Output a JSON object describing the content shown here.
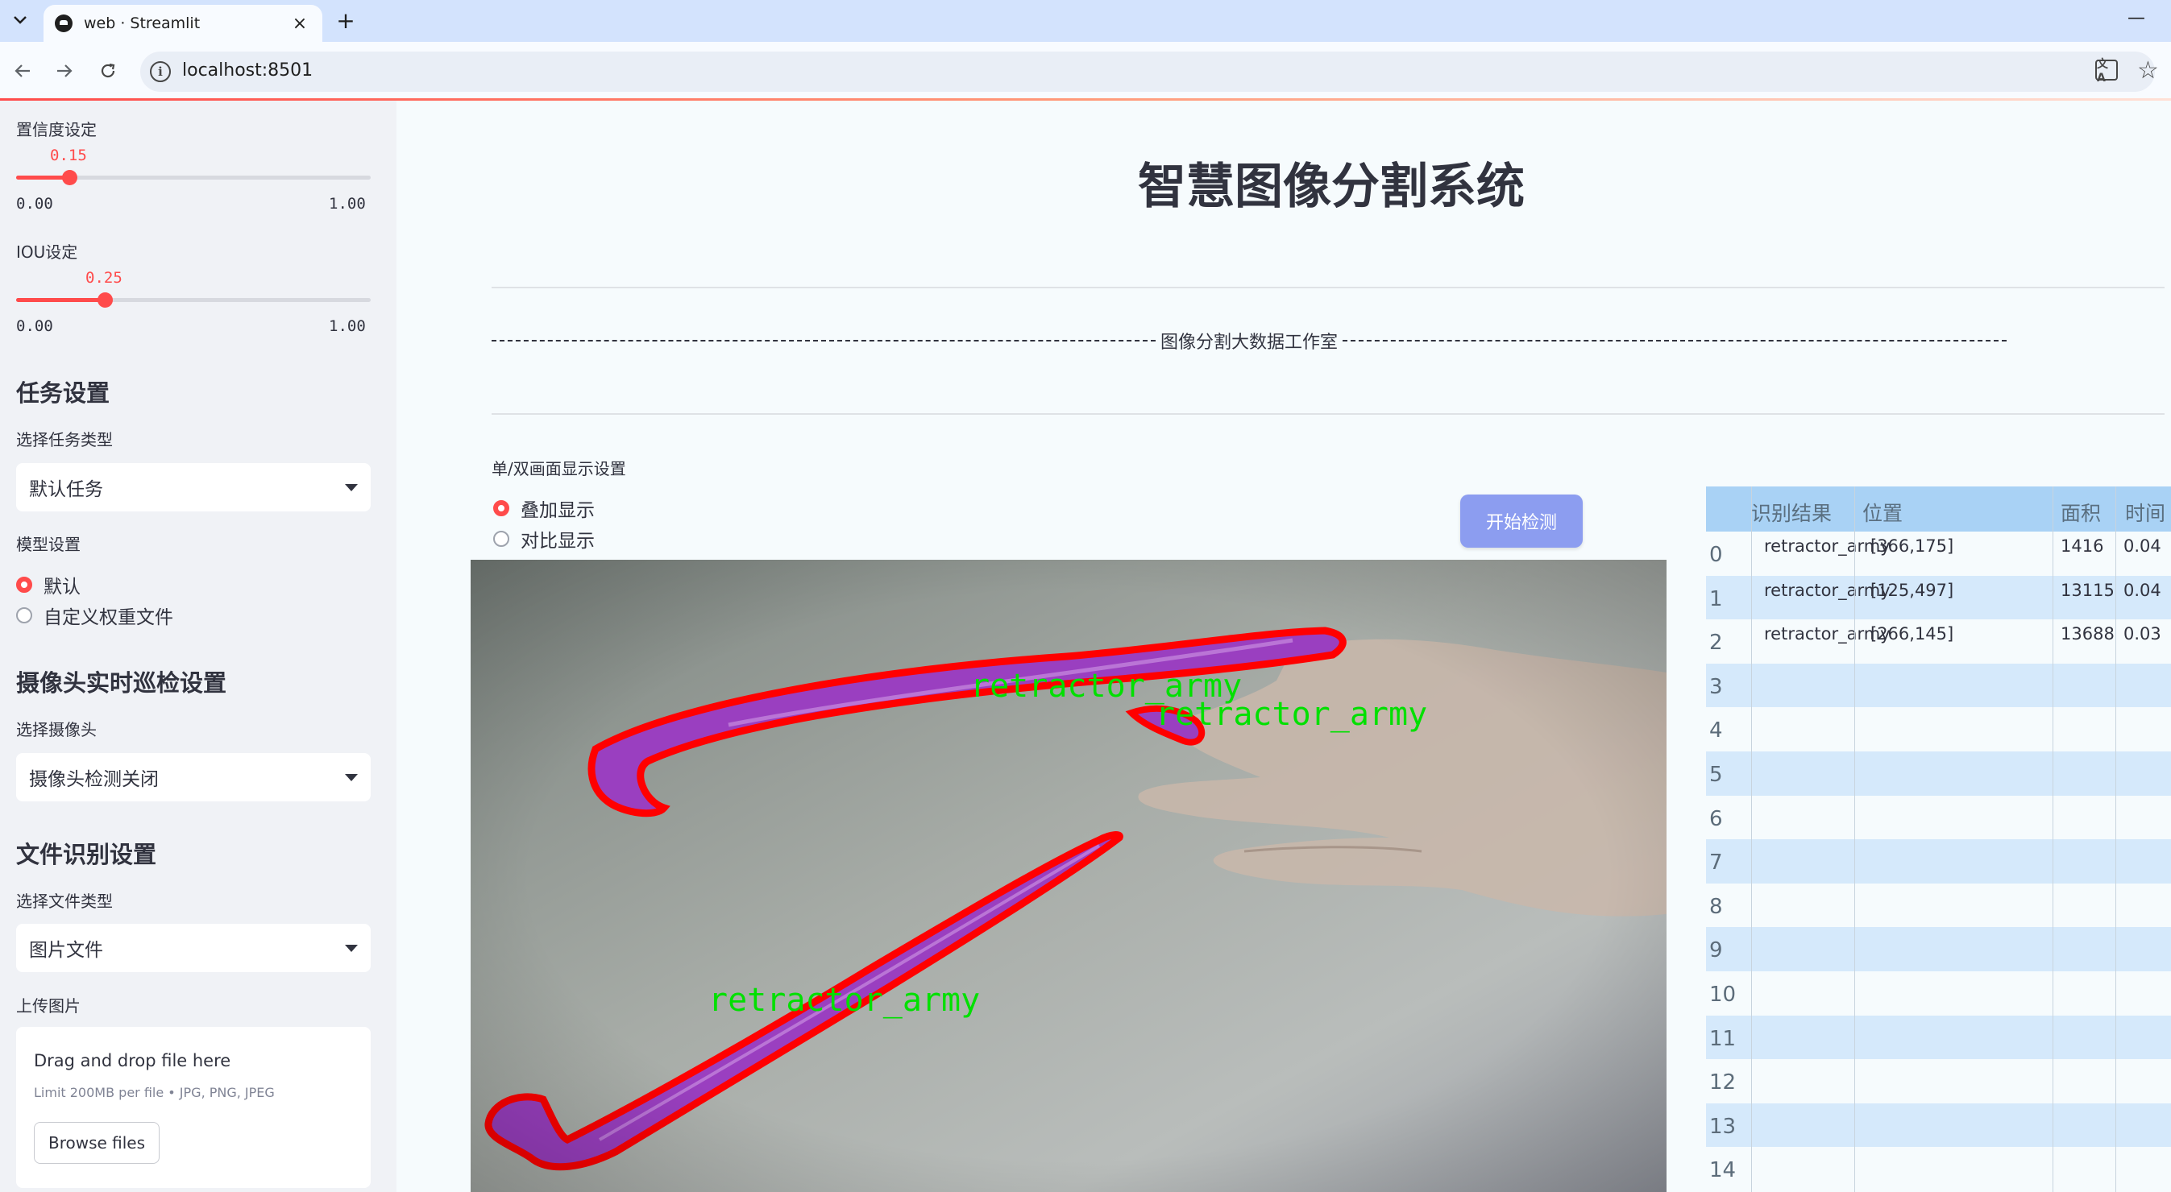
{
  "browser": {
    "tab_title": "web · Streamlit",
    "tab_close": "×",
    "new_tab": "+",
    "minimize": "—",
    "url": "localhost:8501",
    "translate_glyph": "文A"
  },
  "sidebar": {
    "confidence": {
      "label": "置信度设定",
      "value": "0.15",
      "fraction": 0.15,
      "min": "0.00",
      "max": "1.00"
    },
    "iou": {
      "label": "IOU设定",
      "value": "0.25",
      "fraction": 0.25,
      "min": "0.00",
      "max": "1.00"
    },
    "task_heading": "任务设置",
    "task_type_label": "选择任务类型",
    "task_type_value": "默认任务",
    "model_label": "模型设置",
    "model_options": [
      "默认",
      "自定义权重文件"
    ],
    "camera_heading": "摄像头实时巡检设置",
    "camera_label": "选择摄像头",
    "camera_value": "摄像头检测关闭",
    "file_heading": "文件识别设置",
    "file_type_label": "选择文件类型",
    "file_type_value": "图片文件",
    "upload_label": "上传图片",
    "upload_main": "Drag and drop file here",
    "upload_sub": "Limit 200MB per file • JPG, PNG, JPEG",
    "browse_label": "Browse files"
  },
  "main": {
    "title": "智慧图像分割系统",
    "subtitle": "图像分割大数据工作室",
    "display_mode_label": "单/双画面显示设置",
    "display_options": [
      "叠加显示",
      "对比显示"
    ],
    "start_button": "开始检测",
    "detections": [
      "retractor_army",
      "retractor_army",
      "retractor_army"
    ]
  },
  "table": {
    "headers": [
      "识别结果",
      "位置",
      "面积",
      "时间"
    ],
    "rows": [
      {
        "idx": "0",
        "result": "retractor_army",
        "location": "[366,175]",
        "area": "1416",
        "time": "0.04"
      },
      {
        "idx": "1",
        "result": "retractor_army",
        "location": "[125,497]",
        "area": "13115",
        "time": "0.04"
      },
      {
        "idx": "2",
        "result": "retractor_army",
        "location": "[266,145]",
        "area": "13688",
        "time": "0.03"
      },
      {
        "idx": "3"
      },
      {
        "idx": "4"
      },
      {
        "idx": "5"
      },
      {
        "idx": "6"
      },
      {
        "idx": "7"
      },
      {
        "idx": "8"
      },
      {
        "idx": "9"
      },
      {
        "idx": "10"
      },
      {
        "idx": "11"
      },
      {
        "idx": "12"
      },
      {
        "idx": "13"
      },
      {
        "idx": "14"
      }
    ]
  },
  "colors": {
    "accent": "#ff4b4b",
    "start_button": "#8c9df0",
    "table_header": "#a9d2f5",
    "table_row_alt": "#d5e9fb",
    "mask_outline": "#ff0000",
    "mask_fill": "#9a3fc0",
    "label_text": "#00e000"
  }
}
